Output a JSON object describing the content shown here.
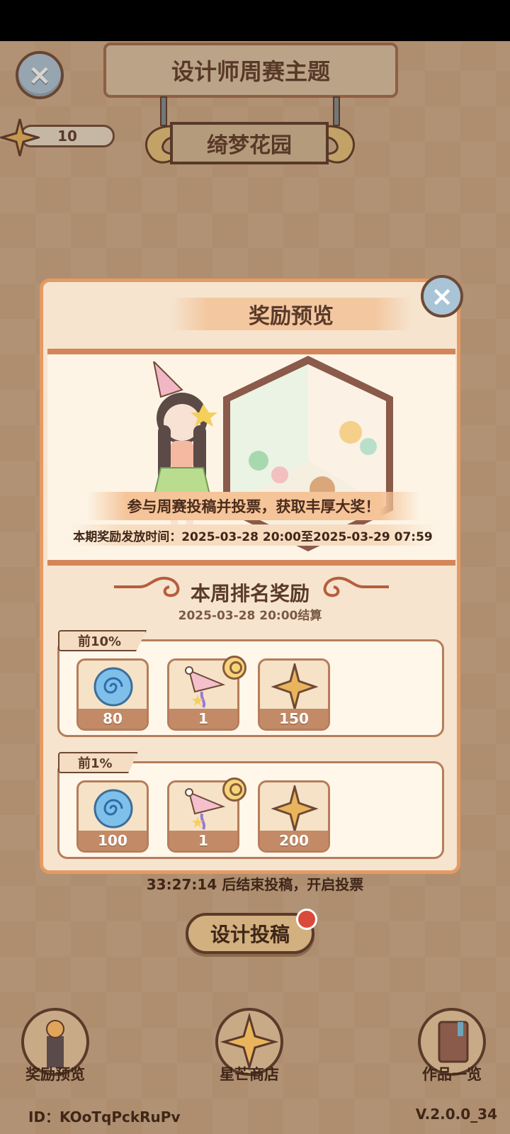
{
  "header": {
    "title": "设计师周赛主题",
    "theme_name": "绮梦花园"
  },
  "currency": {
    "amount": "10",
    "icon": "star-icon"
  },
  "modal": {
    "title": "奖励预览",
    "slogan": "参与周赛投稿并投票，获取丰厚大奖！",
    "release_time": "本期奖励发放时间：2025-03-28 20:00至2025-03-29 07:59",
    "ranking_title": "本周排名奖励",
    "settle_time": "2025-03-28 20:00结算",
    "tiers": [
      {
        "label": "前10%",
        "rewards": [
          {
            "icon": "blue-swirl-orb-icon",
            "qty": "80"
          },
          {
            "icon": "party-hat-item-icon",
            "qty": "1"
          },
          {
            "icon": "star-icon",
            "qty": "150"
          }
        ]
      },
      {
        "label": "前1%",
        "rewards": [
          {
            "icon": "blue-swirl-orb-icon",
            "qty": "100"
          },
          {
            "icon": "party-hat-item-icon",
            "qty": "1"
          },
          {
            "icon": "star-icon",
            "qty": "200"
          }
        ]
      }
    ]
  },
  "countdown": "33:27:14 后结束投稿，开启投票",
  "design_button": "设计投稿",
  "nav": {
    "left": "奖励预览",
    "center": "星芒商店",
    "right": "作品一览"
  },
  "footer": {
    "id": "ID：KOoTqPckRuPv",
    "version": "V.2.0.0_34"
  },
  "colors": {
    "accent_orange": "#e59a63",
    "frame_brown": "#5a3a2a",
    "close_blue": "#a9c4d6",
    "notify_red": "#d94a3a"
  }
}
